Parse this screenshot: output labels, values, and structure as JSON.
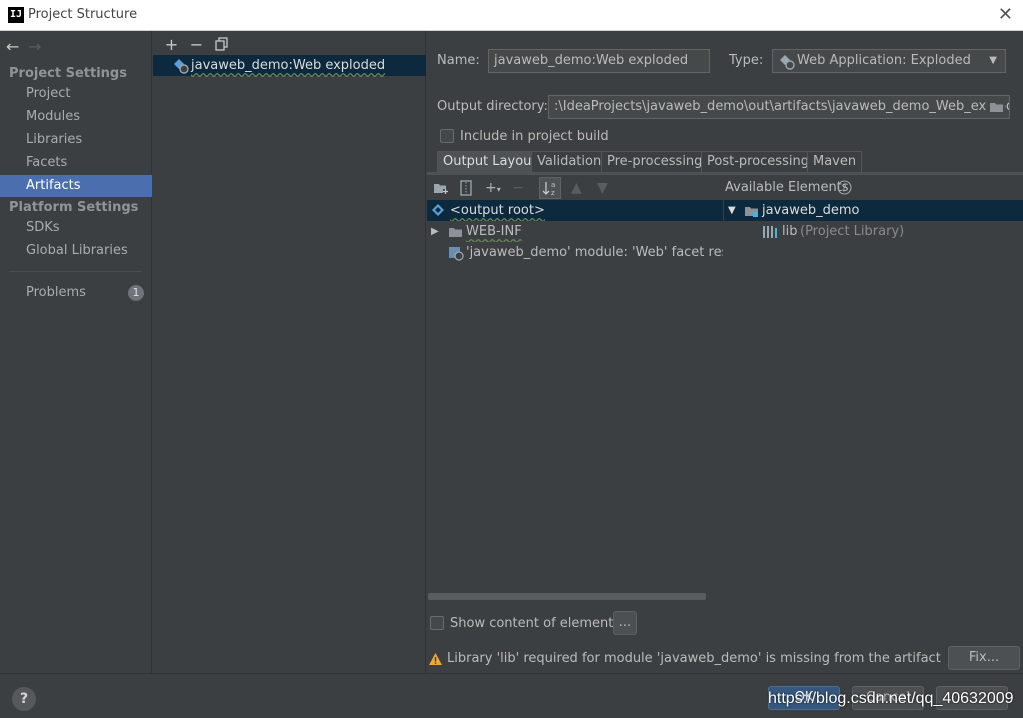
{
  "window": {
    "title": "Project Structure",
    "app_icon_text": "IJ"
  },
  "sidebar": {
    "sections": [
      {
        "title": "Project Settings",
        "items": [
          "Project",
          "Modules",
          "Libraries",
          "Facets",
          "Artifacts"
        ]
      },
      {
        "title": "Platform Settings",
        "items": [
          "SDKs",
          "Global Libraries"
        ]
      }
    ],
    "selected": "Artifacts",
    "problems": {
      "label": "Problems",
      "count": "1"
    }
  },
  "middle": {
    "toolbar": [
      "+",
      "−",
      "copy"
    ],
    "artifacts": [
      "javaweb_demo:Web exploded"
    ]
  },
  "form": {
    "name_label": "Name:",
    "name_value": "javaweb_demo:Web exploded",
    "type_label": "Type:",
    "type_value": "Web Application: Exploded",
    "output_label": "Output directory:",
    "output_value": ":\\IdeaProjects\\javaweb_demo\\out\\artifacts\\javaweb_demo_Web_exploded",
    "include_build_label": "Include in project build",
    "include_build_checked": false
  },
  "tabs": [
    "Output Layout",
    "Validation",
    "Pre-processing",
    "Post-processing",
    "Maven"
  ],
  "active_tab": "Output Layout",
  "layout": {
    "available_label": "Available Elements",
    "tree": [
      {
        "text": "<output root>",
        "selected": true
      },
      {
        "text": "WEB-INF",
        "expandable": true
      },
      {
        "text": "'javaweb_demo' module: 'Web' facet resourc"
      }
    ],
    "available": [
      {
        "text": "javaweb_demo",
        "selected": true,
        "expanded": true
      },
      {
        "text": "lib",
        "suffix": "(Project Library)"
      }
    ]
  },
  "footer": {
    "show_content_label": "Show content of elements",
    "show_content_checked": false,
    "more_button": "...",
    "warning": "Library 'lib' required for module 'javaweb_demo' is missing from the artifact",
    "fix_button": "Fix..."
  },
  "bottom": {
    "help": "?",
    "ok": "OK",
    "cancel": "Cancel",
    "watermark": "https://blog.csdn.net/qq_40632009"
  },
  "colors": {
    "selection": "#4b6eaf",
    "tree_selection": "#0d293e",
    "background": "#3c3f41"
  }
}
